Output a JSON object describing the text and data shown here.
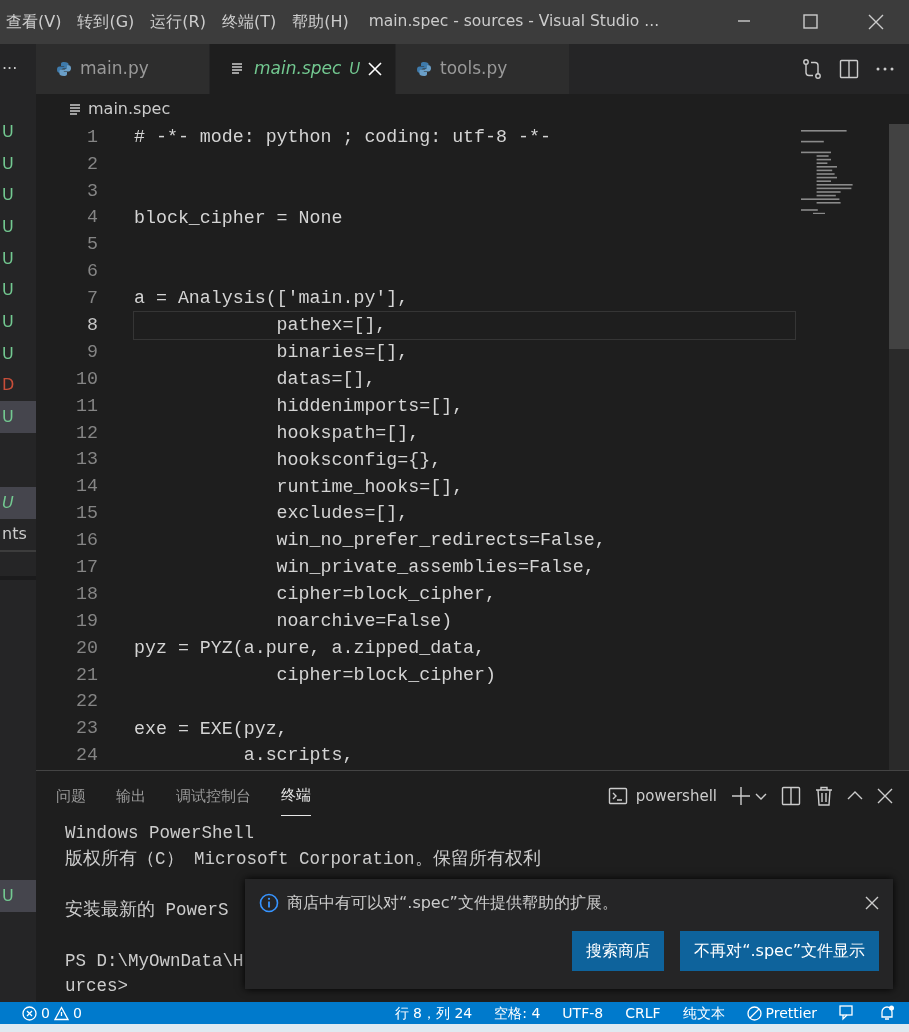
{
  "menu": [
    {
      "label": "查看(V)"
    },
    {
      "label": "转到(G)"
    },
    {
      "label": "运行(R)"
    },
    {
      "label": "终端(T)"
    },
    {
      "label": "帮助(H)"
    }
  ],
  "window": {
    "title": "main.spec - sources - Visual Studio ..."
  },
  "sidebar": {
    "more": "···",
    "sections": [
      {
        "items": [
          {
            "text": "U",
            "color": "#73c991",
            "selected": false
          },
          {
            "text": "U",
            "color": "#73c991",
            "selected": false
          },
          {
            "text": "U",
            "color": "#73c991",
            "selected": false
          },
          {
            "text": "U",
            "color": "#73c991",
            "selected": false
          },
          {
            "text": "U",
            "color": "#73c991",
            "selected": false
          },
          {
            "text": "U",
            "color": "#73c991",
            "selected": false
          },
          {
            "text": "U",
            "color": "#73c991",
            "selected": false
          },
          {
            "text": "U",
            "color": "#73c991",
            "selected": false
          },
          {
            "text": "D",
            "color": "#c74e39",
            "selected": false
          },
          {
            "text": "U",
            "color": "#73c991",
            "selected": true
          }
        ]
      },
      {
        "items": [
          {
            "text": "U",
            "color": "#73c991",
            "selected": true,
            "italic": true
          },
          {
            "text": "nts",
            "color": "#cccccc",
            "selected": false
          }
        ]
      },
      {
        "items": [
          {
            "text": "U",
            "color": "#73c991",
            "selected": true
          }
        ]
      }
    ]
  },
  "tabs": [
    {
      "label": "main.py",
      "kind": "python",
      "selected": false
    },
    {
      "label": "main.spec",
      "kind": "text",
      "selected": true,
      "badge": "U"
    },
    {
      "label": "tools.py",
      "kind": "python",
      "selected": false
    }
  ],
  "breadcrumb": "main.spec",
  "editor": {
    "lines": [
      {
        "number": "1",
        "text": "# -*- mode: python ; coding: utf-8 -*-",
        "current": false
      },
      {
        "number": "2",
        "current": false
      },
      {
        "number": "3",
        "current": false
      },
      {
        "number": "4",
        "text": "block_cipher = None",
        "current": false
      },
      {
        "number": "5",
        "current": false
      },
      {
        "number": "6",
        "current": false
      },
      {
        "number": "7",
        "text": "a = Analysis(['main.py'],",
        "current": false
      },
      {
        "number": "8",
        "text": "             pathex=[],",
        "current": true
      },
      {
        "number": "9",
        "text": "             binaries=[],",
        "current": false
      },
      {
        "number": "10",
        "text": "             datas=[],",
        "current": false
      },
      {
        "number": "11",
        "text": "             hiddenimports=[],",
        "current": false
      },
      {
        "number": "12",
        "text": "             hookspath=[],",
        "current": false
      },
      {
        "number": "13",
        "text": "             hooksconfig={},",
        "current": false
      },
      {
        "number": "14",
        "text": "             runtime_hooks=[],",
        "current": false
      },
      {
        "number": "15",
        "text": "             excludes=[],",
        "current": false
      },
      {
        "number": "16",
        "text": "             win_no_prefer_redirects=False,",
        "current": false
      },
      {
        "number": "17",
        "text": "             win_private_assemblies=False,",
        "current": false
      },
      {
        "number": "18",
        "text": "             cipher=block_cipher,",
        "current": false
      },
      {
        "number": "19",
        "text": "             noarchive=False)",
        "current": false
      },
      {
        "number": "20",
        "text": "pyz = PYZ(a.pure, a.zipped_data,",
        "current": false
      },
      {
        "number": "21",
        "text": "             cipher=block_cipher)",
        "current": false
      },
      {
        "number": "22",
        "current": false
      },
      {
        "number": "23",
        "text": "exe = EXE(pyz,",
        "current": false
      },
      {
        "number": "24",
        "text": "          a.scripts,",
        "current": false
      }
    ]
  },
  "panel": {
    "tabs": [
      {
        "label": "问题",
        "selected": false
      },
      {
        "label": "输出",
        "selected": false
      },
      {
        "label": "调试控制台",
        "selected": false
      },
      {
        "label": "终端",
        "selected": true
      }
    ],
    "shell": "powershell",
    "terminal": [
      [
        "Windows PowerShell",
        "版权所有（C） Microsoft Corporation。保留所有权利"
      ],
      [
        "安装最新的 PowerS"
      ],
      [
        "PS D:\\MyOwnData\\H",
        "urces>"
      ]
    ]
  },
  "notification": {
    "message": "商店中有可以对“.spec”文件提供帮助的扩展。",
    "buttons": [
      "搜索商店",
      "不再对“.spec”文件显示"
    ]
  },
  "status_bar": {
    "errors": "0",
    "warnings": "0",
    "items": [
      "行 8，列 24",
      "空格: 4",
      "UTF-8",
      "CRLF",
      "纯文本",
      "Prettier"
    ]
  }
}
